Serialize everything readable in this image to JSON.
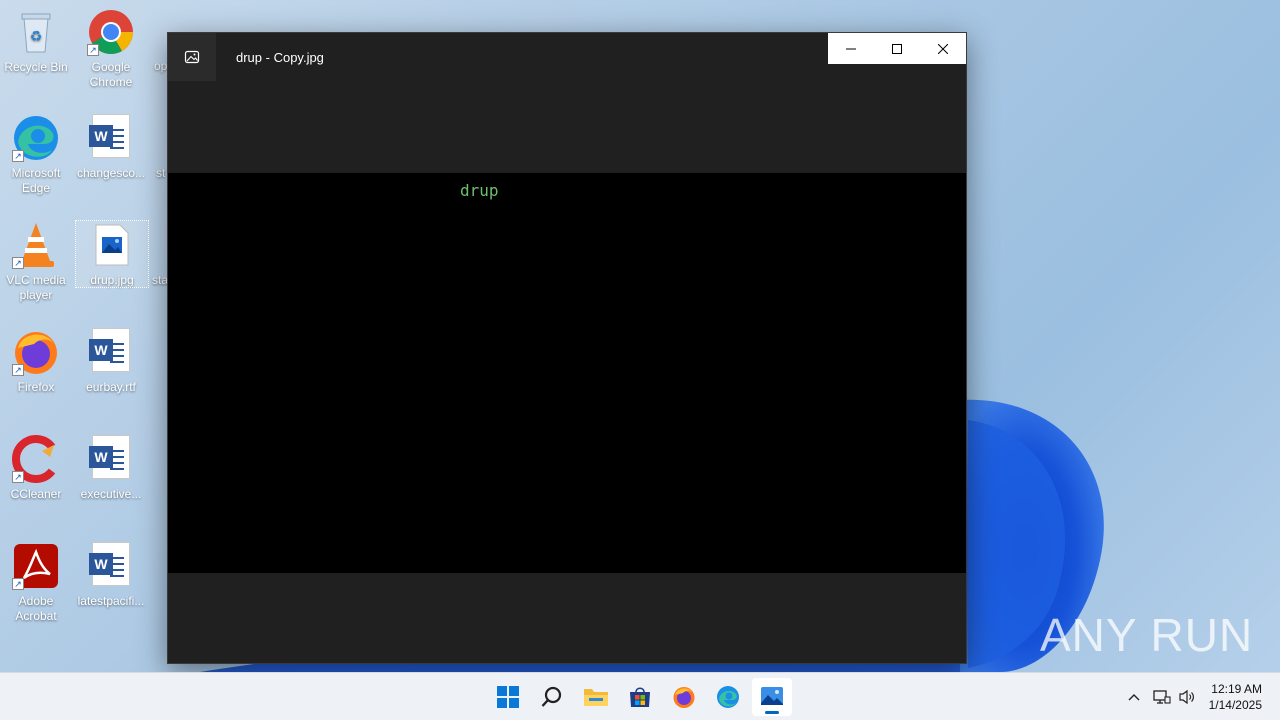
{
  "desktop": {
    "icons": [
      {
        "label": "Recycle Bin"
      },
      {
        "label": "Google Chrome"
      },
      {
        "label": "op"
      },
      {
        "label": "Microsoft Edge"
      },
      {
        "label": "changesco..."
      },
      {
        "label": "st"
      },
      {
        "label": "VLC media player"
      },
      {
        "label": "drup.jpg"
      },
      {
        "label": "sta"
      },
      {
        "label": "Firefox"
      },
      {
        "label": "eurbay.rtf"
      },
      {
        "label": "CCleaner"
      },
      {
        "label": "executive..."
      },
      {
        "label": "Adobe Acrobat"
      },
      {
        "label": "latestpacifi..."
      }
    ]
  },
  "window": {
    "title": "drup - Copy.jpg",
    "image_text": "drup",
    "app_icon": "photos-icon",
    "controls": [
      "minimize-icon",
      "maximize-icon",
      "close-icon"
    ]
  },
  "taskbar": {
    "apps": [
      "start-icon",
      "search-icon",
      "file-explorer-icon",
      "store-icon",
      "firefox-icon",
      "edge-icon",
      "photos-icon"
    ],
    "active_app": "photos-icon",
    "tray": [
      "chevron-up-icon",
      "network-icon",
      "volume-icon"
    ],
    "time": "12:19 AM",
    "date": "1/14/2025"
  },
  "watermark": "ANY RUN",
  "colors": {
    "window_bg": "#202020",
    "image_bg": "#000000",
    "image_text": "#6dbf6d",
    "taskbar_bg": "#eef1f5",
    "accent": "#0067c0"
  }
}
